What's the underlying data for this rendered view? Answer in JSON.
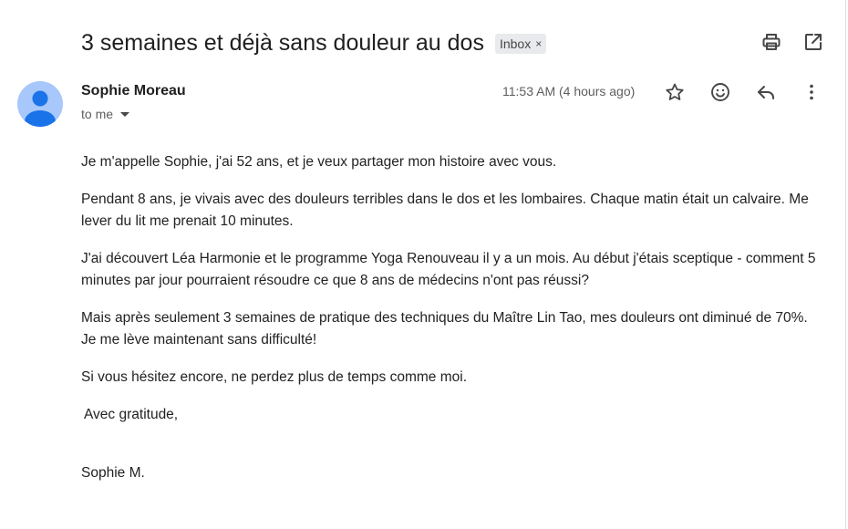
{
  "email": {
    "subject": "3 semaines et déjà sans douleur au dos",
    "label": "Inbox",
    "label_remove": "×",
    "sender": "Sophie Moreau",
    "recipient": "to me",
    "timestamp": "11:53 AM (4 hours ago)",
    "body": {
      "p1": "Je m'appelle Sophie, j'ai 52 ans, et je veux partager mon histoire avec vous.",
      "p2": "Pendant 8 ans, je vivais avec des douleurs terribles dans le dos et les lombaires. Chaque matin était un calvaire. Me lever du lit me prenait 10 minutes.",
      "p3": "J'ai découvert Léa Harmonie et le programme Yoga Renouveau il y a un mois. Au début j'étais sceptique - comment 5 minutes par jour pourraient résoudre ce que 8 ans de médecins n'ont pas réussi?",
      "p4": "Mais après seulement 3 semaines de pratique des techniques du Maître Lin Tao, mes douleurs ont diminué de 70%. Je me lève maintenant sans difficulté!",
      "p5": "Si vous hésitez encore, ne perdez plus de temps comme moi.",
      "closing": "Avec gratitude,",
      "signature": "Sophie M."
    }
  },
  "icons": {
    "print": "print-icon",
    "open_new_window": "open-in-new-icon",
    "star": "star-icon",
    "emoji": "emoji-icon",
    "reply": "reply-icon",
    "more": "more-vert-icon",
    "avatar": "person-icon",
    "caret": "caret-down-icon"
  },
  "colors": {
    "avatar_bg": "#a8c7fa",
    "avatar_fg": "#1a73e8",
    "chip_bg": "#e8eaed",
    "icon": "#444746"
  }
}
